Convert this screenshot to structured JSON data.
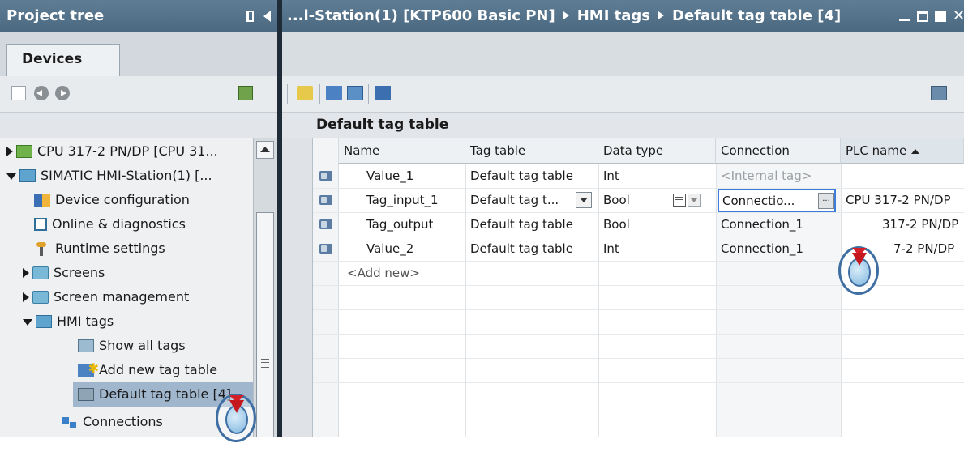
{
  "left_panel": {
    "title": "Project tree",
    "tab": "Devices",
    "tree": [
      {
        "label": "CPU 317-2 PN/DP [CPU 31...",
        "icon": "cpu-icon",
        "expander": "collapsed"
      },
      {
        "label": "SIMATIC HMI-Station(1) [...",
        "icon": "hmi-station-icon",
        "expander": "expanded"
      },
      {
        "label": "Device configuration",
        "icon": "device-configuration-icon"
      },
      {
        "label": "Online & diagnostics",
        "icon": "diagnostics-icon"
      },
      {
        "label": "Runtime settings",
        "icon": "wrench-icon"
      },
      {
        "label": "Screens",
        "icon": "folder-icon",
        "expander": "collapsed"
      },
      {
        "label": "Screen management",
        "icon": "folder-icon",
        "expander": "collapsed"
      },
      {
        "label": "HMI tags",
        "icon": "hmi-tags-folder-icon",
        "expander": "expanded"
      },
      {
        "label": "Show all tags",
        "icon": "show-tags-icon"
      },
      {
        "label": "Add new tag table",
        "icon": "add-tag-table-icon"
      },
      {
        "label": "Default tag table [4]",
        "icon": "tag-table-icon",
        "selected": true
      },
      {
        "label": "Connections",
        "icon": "connections-icon"
      }
    ]
  },
  "right_panel": {
    "breadcrumb": [
      "...l-Station(1) [KTP600 Basic PN]",
      "HMI tags",
      "Default tag table [4]"
    ],
    "table_title": "Default tag table",
    "columns": [
      "Name",
      "Tag table",
      "Data type",
      "Connection",
      "PLC name"
    ],
    "sorted_column": "PLC name",
    "rows": [
      {
        "name": "Value_1",
        "tag_table": "Default tag table",
        "data_type": "Int",
        "connection": "<Internal tag>",
        "plc_name": ""
      },
      {
        "name": "Tag_input_1",
        "tag_table": "Default tag t...",
        "data_type": "Bool",
        "connection": "Connectio...",
        "plc_name": "CPU 317-2 PN/DP"
      },
      {
        "name": "Tag_output",
        "tag_table": "Default tag table",
        "data_type": "Bool",
        "connection": "Connection_1",
        "plc_name": "317-2 PN/DP"
      },
      {
        "name": "Value_2",
        "tag_table": "Default tag table",
        "data_type": "Int",
        "connection": "Connection_1",
        "plc_name": "7-2 PN/DP"
      }
    ],
    "add_new": "<Add new>",
    "ellipsis_button": "..."
  },
  "colors": {
    "title_bar": "#4a6880",
    "selection": "#9fb6cc",
    "accent": "#3c7dd9"
  }
}
